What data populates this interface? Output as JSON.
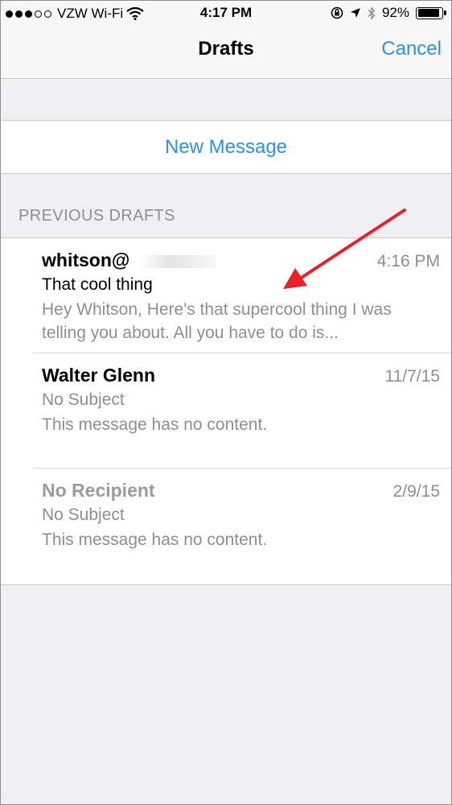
{
  "status_bar": {
    "carrier": "VZW Wi-Fi",
    "time": "4:17 PM",
    "battery": "92%",
    "battery_level": 0.92,
    "signal_dots_filled": 3,
    "signal_dots_total": 5,
    "icons": [
      "wifi-icon",
      "orientation-lock-icon",
      "location-icon",
      "bluetooth-icon",
      "battery-icon"
    ]
  },
  "nav": {
    "title": "Drafts",
    "cancel_label": "Cancel"
  },
  "new_message_label": "New Message",
  "section_header": "PREVIOUS DRAFTS",
  "drafts": [
    {
      "sender": "whitson@",
      "date": "4:16 PM",
      "subject": "That cool thing",
      "preview": "Hey Whitson, Here's that supercool thing I was telling you about. All you have to do is..."
    },
    {
      "sender": "Walter Glenn",
      "date": "11/7/15",
      "subject": "No Subject",
      "preview": "This message has no content."
    },
    {
      "sender": "No Recipient",
      "date": "2/9/15",
      "subject": "No Subject",
      "preview": "This message has no content."
    }
  ],
  "colors": {
    "accent": "#2c8ef7",
    "annotation_arrow": "#e8202a",
    "background": "#efeff4"
  }
}
